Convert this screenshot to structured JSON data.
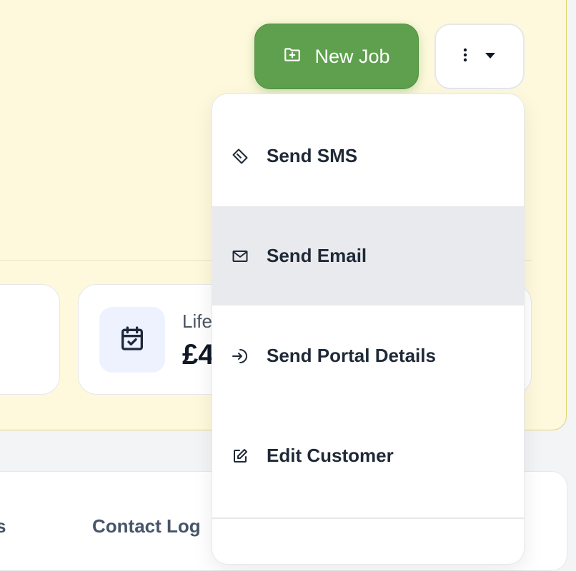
{
  "header": {
    "new_job_label": "New Job"
  },
  "stats": {
    "lifetime_label": "Life",
    "lifetime_value": "£4"
  },
  "tabs": [
    "s",
    "Contact Log"
  ],
  "menu": {
    "items": [
      {
        "label": "Send SMS",
        "icon": "sms-icon"
      },
      {
        "label": "Send Email",
        "icon": "mail-icon"
      },
      {
        "label": "Send Portal Details",
        "icon": "portal-login-icon"
      },
      {
        "label": "Edit Customer",
        "icon": "edit-icon"
      }
    ],
    "active_index": 1
  },
  "colors": {
    "accent_green": "#5fa04e",
    "panel_yellow": "#fef9dc",
    "panel_border": "#e2d46a",
    "menu_hover": "#e9eaee",
    "icon_tile": "#eef2ff"
  }
}
